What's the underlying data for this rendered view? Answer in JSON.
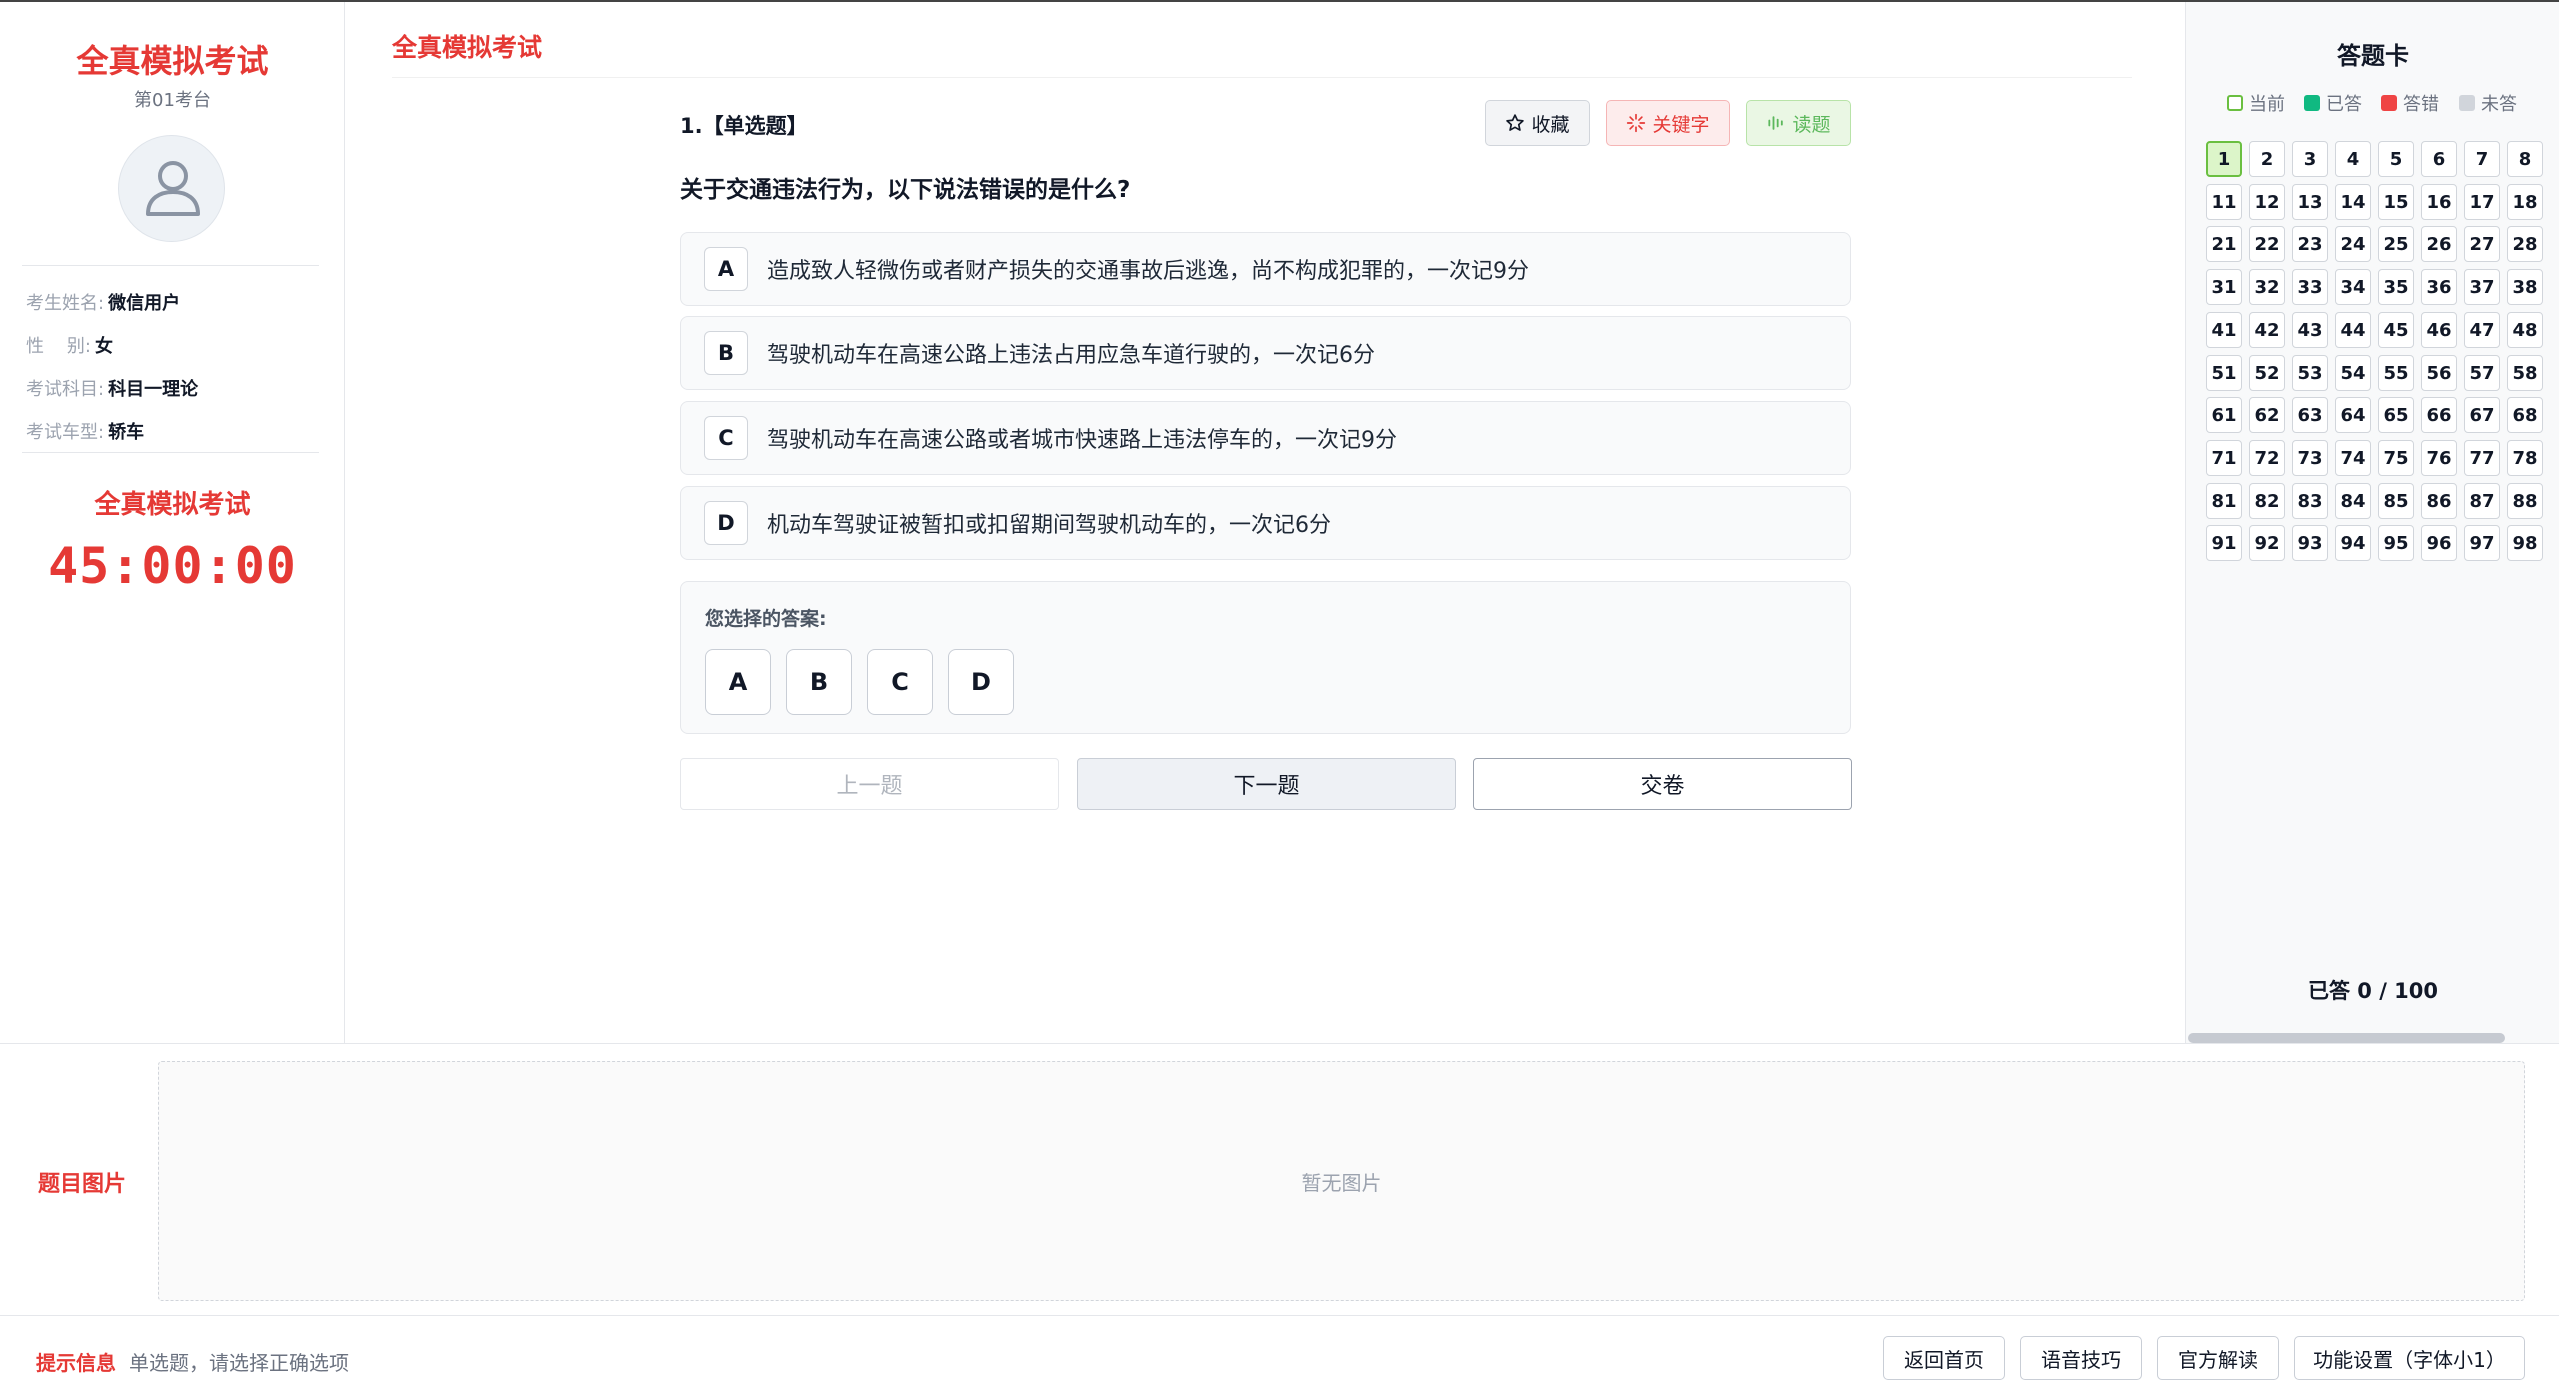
{
  "left_panel": {
    "title": "全真模拟考试",
    "seat": "第01考台",
    "info": [
      {
        "label": "考生姓名:",
        "value": "微信用户"
      },
      {
        "label": "性    别:",
        "value": "女"
      },
      {
        "label": "考试科目:",
        "value": "科目一理论"
      },
      {
        "label": "考试车型:",
        "value": "轿车"
      }
    ],
    "exam_title": "全真模拟考试",
    "timer": "45:00:00"
  },
  "main": {
    "title": "全真模拟考试",
    "question_header": "1.【单选题】",
    "tools": {
      "favorite": "收藏",
      "keyword": "关键字",
      "read": "读题"
    },
    "question": "关于交通违法行为，以下说法错误的是什么?",
    "options": [
      {
        "letter": "A",
        "text": "造成致人轻微伤或者财产损失的交通事故后逃逸，尚不构成犯罪的，一次记9分"
      },
      {
        "letter": "B",
        "text": "驾驶机动车在高速公路上违法占用应急车道行驶的，一次记6分"
      },
      {
        "letter": "C",
        "text": "驾驶机动车在高速公路或者城市快速路上违法停车的，一次记9分"
      },
      {
        "letter": "D",
        "text": "机动车驾驶证被暂扣或扣留期间驾驶机动车的，一次记6分"
      }
    ],
    "answer_label": "您选择的答案:",
    "answer_choices": [
      "A",
      "B",
      "C",
      "D"
    ],
    "nav": {
      "prev": "上一题",
      "next": "下一题",
      "submit": "交卷"
    }
  },
  "answer_card": {
    "title": "答题卡",
    "legend": [
      {
        "label": "当前",
        "color": "#6abf40"
      },
      {
        "label": "已答",
        "color": "#10b981"
      },
      {
        "label": "答错",
        "color": "#ef4444"
      },
      {
        "label": "未答",
        "color": "#d1d5db"
      }
    ],
    "numbers": [
      "1",
      "2",
      "3",
      "4",
      "5",
      "6",
      "7",
      "8",
      "11",
      "12",
      "13",
      "14",
      "15",
      "16",
      "17",
      "18",
      "21",
      "22",
      "23",
      "24",
      "25",
      "26",
      "27",
      "28",
      "31",
      "32",
      "33",
      "34",
      "35",
      "36",
      "37",
      "38",
      "41",
      "42",
      "43",
      "44",
      "45",
      "46",
      "47",
      "48",
      "51",
      "52",
      "53",
      "54",
      "55",
      "56",
      "57",
      "58",
      "61",
      "62",
      "63",
      "64",
      "65",
      "66",
      "67",
      "68",
      "71",
      "72",
      "73",
      "74",
      "75",
      "76",
      "77",
      "78",
      "81",
      "82",
      "83",
      "84",
      "85",
      "86",
      "87",
      "88",
      "91",
      "92",
      "93",
      "94",
      "95",
      "96",
      "97",
      "98"
    ],
    "current": "1",
    "progress": "已答 0 / 100"
  },
  "image_section": {
    "label": "题目图片",
    "placeholder": "暂无图片"
  },
  "footer": {
    "hint_label": "提示信息",
    "hint_text": "单选题，请选择正确选项",
    "buttons": [
      "返回首页",
      "语音技巧",
      "官方解读",
      "功能设置（字体小1）"
    ]
  },
  "colors": {
    "accent": "#e53935",
    "current_cell": "#dcf5c9"
  }
}
